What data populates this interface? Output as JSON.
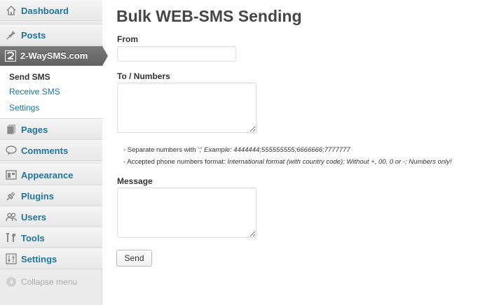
{
  "sidebar": {
    "dashboard": "Dashboard",
    "posts": "Posts",
    "plugin_menu": "2-WaySMS.com",
    "submenu": [
      "Send SMS",
      "Receive SMS",
      "Settings"
    ],
    "pages": "Pages",
    "comments": "Comments",
    "appearance": "Appearance",
    "plugins": "Plugins",
    "users": "Users",
    "tools": "Tools",
    "settings": "Settings",
    "collapse": "Collapse menu"
  },
  "main": {
    "title": "Bulk WEB-SMS Sending",
    "from_label": "From",
    "from_value": "",
    "to_label": "To / Numbers",
    "to_value": "",
    "hint1_prefix": "- Separate numbers with ';' ",
    "hint1_example": "Example: 4444444;555555555;6666666;7777777",
    "hint2_prefix": "- Accepted phone numbers format: ",
    "hint2_example": "International format (with country code); Without +, 00, 0 or -; Numbers only!",
    "message_label": "Message",
    "message_value": "",
    "send_label": "Send"
  },
  "colors": {
    "link": "#21759b",
    "current_menu_bg": "#6d6d6d",
    "sidebar_bg": "#ececec"
  }
}
